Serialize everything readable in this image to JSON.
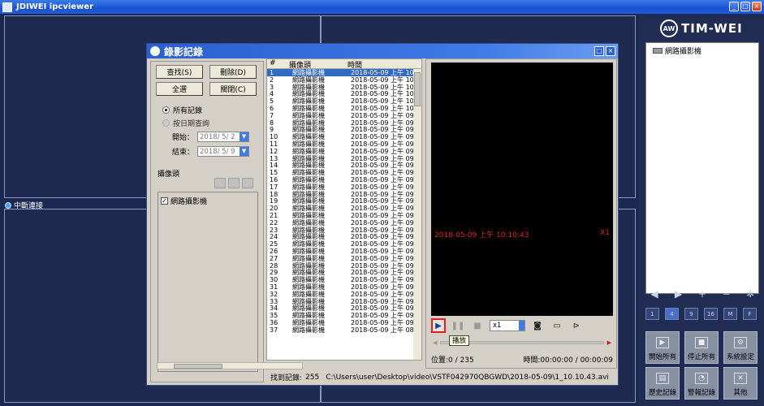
{
  "app": {
    "title": "JDIWEI ipcviewer"
  },
  "video_area": {
    "cell_status": "中斷連接"
  },
  "right_panel": {
    "logo_text": "TIM-WEI",
    "logo_badge": "AW",
    "tree_item": "網路攝影機",
    "tools": [
      "◀",
      "▶",
      "+",
      "−",
      "✲"
    ],
    "layouts": [
      "1",
      "4",
      "9",
      "16",
      "M",
      "F"
    ],
    "functions": [
      "開始所有",
      "停止所有",
      "系統設定",
      "歷史記錄",
      "警報記錄",
      "其他"
    ]
  },
  "dialog": {
    "title": "錄影記錄",
    "buttons": {
      "search": "查找(S)",
      "delete": "刪除(D)",
      "select_all": "全選",
      "close": "關閉(C)"
    },
    "radio_all": "所有記錄",
    "radio_date": "按日期查詢",
    "start_label": "開始：",
    "start_value": "2018/ 5/ 2",
    "end_label": "結束：",
    "end_value": "2018/ 5/ 9",
    "camera_section": "攝像頭",
    "camera_check": "網路攝影機",
    "list": {
      "headers": {
        "num": "#",
        "camera": "攝像頭",
        "time": "時間"
      },
      "rows": [
        [
          "1",
          "網路攝影機",
          "2018-05-09 上午 10:1"
        ],
        [
          "2",
          "網路攝影機",
          "2018-05-09 上午 10:1"
        ],
        [
          "3",
          "網路攝影機",
          "2018-05-09 上午 10:0"
        ],
        [
          "4",
          "網路攝影機",
          "2018-05-09 上午 10:0"
        ],
        [
          "5",
          "網路攝影機",
          "2018-05-09 上午 10:0"
        ],
        [
          "6",
          "網路攝影機",
          "2018-05-09 上午 10:0"
        ],
        [
          "7",
          "網路攝影機",
          "2018-05-09 上午 09:5"
        ],
        [
          "8",
          "網路攝影機",
          "2018-05-09 上午 09:5"
        ],
        [
          "9",
          "網路攝影機",
          "2018-05-09 上午 09:5"
        ],
        [
          "10",
          "網路攝影機",
          "2018-05-09 上午 09:5"
        ],
        [
          "11",
          "網路攝影機",
          "2018-05-09 上午 09:5"
        ],
        [
          "12",
          "網路攝影機",
          "2018-05-09 上午 09:5"
        ],
        [
          "13",
          "網路攝影機",
          "2018-05-09 上午 09:4"
        ],
        [
          "14",
          "網路攝影機",
          "2018-05-09 上午 09:4"
        ],
        [
          "15",
          "網路攝影機",
          "2018-05-09 上午 09:4"
        ],
        [
          "16",
          "網路攝影機",
          "2018-05-09 上午 09:4"
        ],
        [
          "17",
          "網路攝影機",
          "2018-05-09 上午 09:3"
        ],
        [
          "18",
          "網路攝影機",
          "2018-05-09 上午 09:3"
        ],
        [
          "19",
          "網路攝影機",
          "2018-05-09 上午 09:3"
        ],
        [
          "20",
          "網路攝影機",
          "2018-05-09 上午 09:3"
        ],
        [
          "21",
          "網路攝影機",
          "2018-05-09 上午 09:3"
        ],
        [
          "22",
          "網路攝影機",
          "2018-05-09 上午 09:2"
        ],
        [
          "23",
          "網路攝影機",
          "2018-05-09 上午 09:2"
        ],
        [
          "24",
          "網路攝影機",
          "2018-05-09 上午 09:2"
        ],
        [
          "25",
          "網路攝影機",
          "2018-05-09 上午 09:2"
        ],
        [
          "26",
          "網路攝影機",
          "2018-05-09 上午 09:2"
        ],
        [
          "27",
          "網路攝影機",
          "2018-05-09 上午 09:1"
        ],
        [
          "28",
          "網路攝影機",
          "2018-05-09 上午 09:1"
        ],
        [
          "29",
          "網路攝影機",
          "2018-05-09 上午 09:1"
        ],
        [
          "30",
          "網路攝影機",
          "2018-05-09 上午 09:1"
        ],
        [
          "31",
          "網路攝影機",
          "2018-05-09 上午 09:1"
        ],
        [
          "32",
          "網路攝影機",
          "2018-05-09 上午 09:0"
        ],
        [
          "33",
          "網路攝影機",
          "2018-05-09 上午 09:0"
        ],
        [
          "34",
          "網路攝影機",
          "2018-05-09 上午 09:0"
        ],
        [
          "35",
          "網路攝影機",
          "2018-05-09 上午 09:0"
        ],
        [
          "36",
          "網路攝影機",
          "2018-05-09 上午 09:0"
        ],
        [
          "37",
          "網路攝影機",
          "2018-05-09 上午 08:5"
        ]
      ]
    },
    "status": {
      "label": "找到記錄:",
      "count": "255",
      "path": "C:\\Users\\user\\Desktop\\video\\VSTF042970QBGWD\\2018-05-09\\1_10.10.43.avi"
    },
    "player": {
      "osd_time": "2018-05-09 上午 10:10:43",
      "osd_speed": "X1",
      "speed_value": "x1",
      "tooltip": "播放",
      "position": "位置:0 / 235",
      "time": "時間:00:00:00 / 00:00:09"
    }
  },
  "colors": {
    "accent": "#316ac5",
    "background": "#1e2a50",
    "osd": "#e02020"
  }
}
